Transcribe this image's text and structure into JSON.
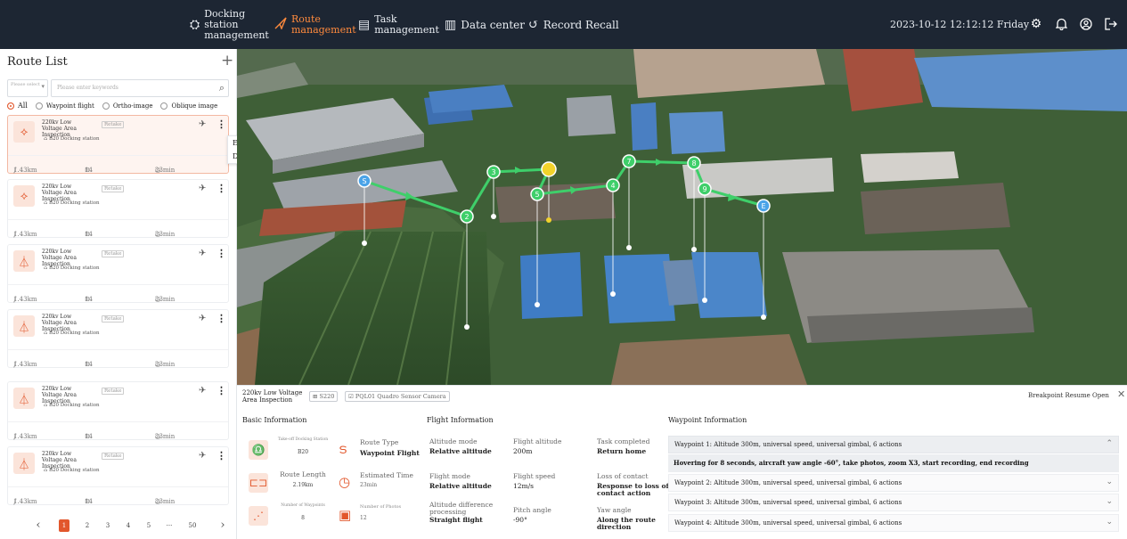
{
  "header": {
    "nav": [
      {
        "label": "Docking station management",
        "icon": "docking-icon",
        "active": false
      },
      {
        "label": "Route management",
        "icon": "route-icon",
        "active": true
      },
      {
        "label": "Task management",
        "icon": "task-icon",
        "active": false
      },
      {
        "label": "Data center",
        "icon": "data-center-icon",
        "active": false
      },
      {
        "label": "Record Recall",
        "icon": "record-recall-icon",
        "active": false
      }
    ],
    "datetime": "2023-10-12 12:12:12 Friday",
    "icons": [
      "settings-icon",
      "bell-icon",
      "user-icon",
      "logout-icon"
    ]
  },
  "sidebar": {
    "title": "Route List",
    "select_placeholder": "Please select",
    "search_placeholder": "Please enter keywords",
    "filters": [
      "All",
      "Waypoint flight",
      "Ortho-image",
      "Oblique image"
    ],
    "selected_filter": "All",
    "routes": [
      {
        "name": "220kv Low Voltage Area Inspection",
        "tag": "Retake",
        "station": "B20 Docking station",
        "distance": "1.43km",
        "waypoints": "14",
        "duration": "23min"
      },
      {
        "name": "220kv Low Voltage Area Inspection",
        "tag": "Retake",
        "station": "B20 Docking station",
        "distance": "1.43km",
        "waypoints": "14",
        "duration": "23min"
      },
      {
        "name": "220kv Low Voltage Area Inspection",
        "tag": "Retake",
        "station": "B20 Docking station",
        "distance": "1.43km",
        "waypoints": "14",
        "duration": "23min"
      },
      {
        "name": "220kv Low Voltage Area Inspection",
        "tag": "Retake",
        "station": "B20 Docking station",
        "distance": "1.43km",
        "waypoints": "14",
        "duration": "23min"
      },
      {
        "name": "220kv Low Voltage Area Inspection",
        "tag": "Retake",
        "station": "B20 Docking station",
        "distance": "1.43km",
        "waypoints": "14",
        "duration": "23min"
      },
      {
        "name": "220kv Low Voltage Area Inspection",
        "tag": "Retake",
        "station": "B20 Docking station",
        "distance": "1.43km",
        "waypoints": "14",
        "duration": "23min"
      }
    ],
    "context_menu": [
      "Edit",
      "Delete"
    ],
    "pagination": {
      "pages": [
        "1",
        "2",
        "3",
        "4",
        "5",
        "···",
        "50"
      ],
      "current": "1"
    }
  },
  "map": {
    "waypoint_markers": [
      "S",
      "2",
      "3",
      "5",
      "4",
      "7",
      "8",
      "9",
      "E"
    ]
  },
  "detail": {
    "route_name": "220kv Low Voltage Area Inspection",
    "drone": "S220",
    "camera": "PQL01 Quadro Sensor Camera",
    "breakpoint_resume": "Breakpoint Resume Open",
    "basic_title": "Basic Information",
    "basic": {
      "takeoff_label": "Take-off Docking Station",
      "takeoff_value": "B20",
      "length_label": "Route Length",
      "length_value": "2.19km",
      "waypoints_label": "Number of Waypoints",
      "waypoints_value": "8",
      "type_label": "Route Type",
      "type_value": "Waypoint Flight",
      "time_label": "Estimated Time",
      "time_value": "23min",
      "photos_label": "Number of Photos",
      "photos_value": "12"
    },
    "flight_title": "Flight Information",
    "flight": [
      {
        "label": "Altitude mode",
        "value": "Relative altitude",
        "bold": true
      },
      {
        "label": "Flight altitude",
        "value": "200m",
        "bold": false
      },
      {
        "label": "Task completed",
        "value": "Return home",
        "bold": true
      },
      {
        "label": "Flight mode",
        "value": "Relative altitude",
        "bold": true
      },
      {
        "label": "Flight speed",
        "value": "12m/s",
        "bold": false
      },
      {
        "label": "Loss of contact",
        "value": "Response to loss of contact action",
        "bold": true
      },
      {
        "label": "Altitude difference processing",
        "value": "Straight flight",
        "bold": true
      },
      {
        "label": "Pitch angle",
        "value": "-90°",
        "bold": false
      },
      {
        "label": "Yaw angle",
        "value": "Along the route direction",
        "bold": true
      }
    ],
    "waypoint_title": "Waypoint Information",
    "waypoints": [
      "Waypoint 1: Altitude 300m, universal speed, universal gimbal, 6 actions",
      "Waypoint 2: Altitude 300m, universal speed, universal gimbal, 6 actions",
      "Waypoint 3: Altitude 300m, universal speed, universal gimbal, 6 actions",
      "Waypoint 4: Altitude 300m, universal speed, universal gimbal, 6 actions"
    ],
    "waypoint_detail": "Hovering for 8 seconds, aircraft yaw angle -60°, take photos, zoom X3, start recording, end recording"
  },
  "colors": {
    "accent": "#e2572c",
    "route": "#3fcf6a",
    "topbar": "#1d2633"
  }
}
